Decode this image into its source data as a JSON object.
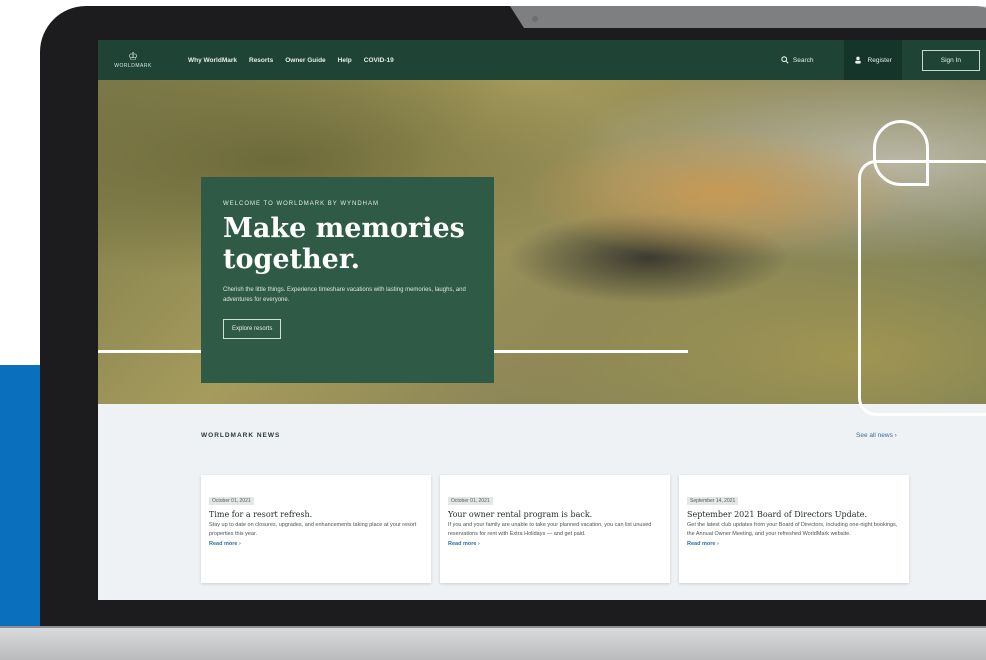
{
  "nav": {
    "logo_text": "WORLDMARK",
    "links": [
      "Why WorldMark",
      "Resorts",
      "Owner Guide",
      "Help",
      "COVID-19"
    ],
    "search_label": "Search",
    "register_label": "Register",
    "signin_label": "Sign In"
  },
  "hero": {
    "eyebrow": "WELCOME TO WORLDMARK BY WYNDHAM",
    "headline": "Make memories together.",
    "body": "Cherish the little things. Experience timeshare vacations with lasting memories, laughs, and adventures for everyone.",
    "button_label": "Explore resorts"
  },
  "news": {
    "section_title": "WORLDMARK NEWS",
    "see_all_label": "See all news",
    "cards": [
      {
        "date": "October 01, 2021",
        "title": "Time for a resort refresh.",
        "body": "Stay up to date on closures, upgrades, and enhancements taking place at your resort properties this year.",
        "link": "Read more"
      },
      {
        "date": "October 01, 2021",
        "title": "Your owner rental program is back.",
        "body": "If you and your family are unable to take your planned vacation, you can list unused reservations for rent with Extra Holidays — and get paid.",
        "link": "Read more"
      },
      {
        "date": "September 14, 2021",
        "title": "September 2021 Board of Directors Update.",
        "body": "Get the latest club updates from your Board of Directors, including one-night bookings, the Annual Owner Meeting, and your refreshed WorldMark website.",
        "link": "Read more"
      }
    ]
  },
  "colors": {
    "brand_green": "#1f4335",
    "card_green": "#2e5a46",
    "link_blue": "#2f6fa8",
    "accent_blue": "#0a6fbd"
  }
}
